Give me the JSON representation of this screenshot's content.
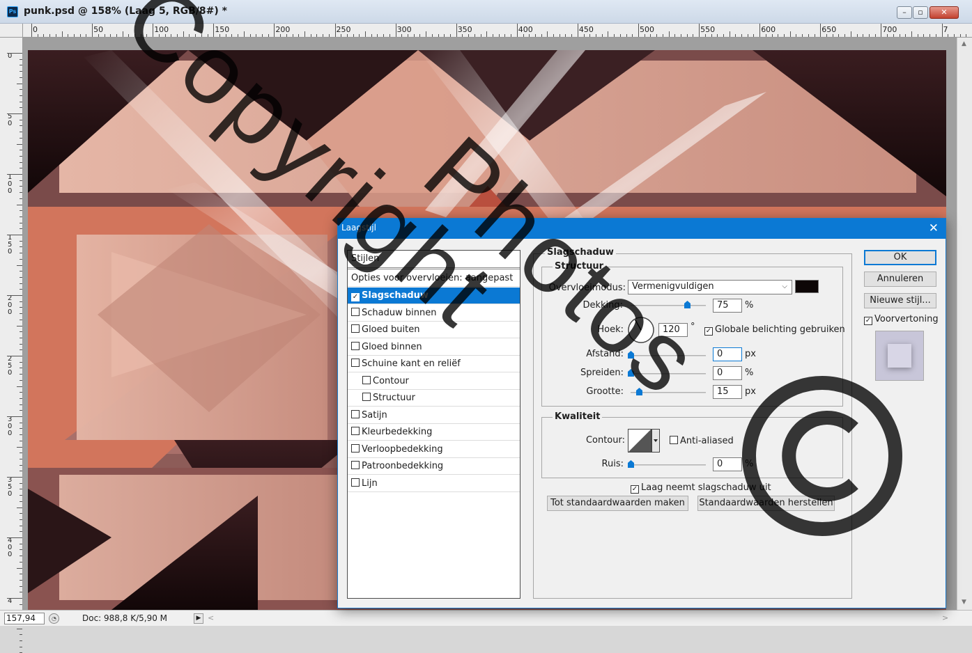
{
  "window": {
    "app_icon_label": "Ps",
    "title": "punk.psd @ 158% (Laag 5, RGB/8#) *",
    "min_glyph": "–",
    "max_glyph": "▫",
    "close_glyph": "✕"
  },
  "ruler_top_labels": [
    "0",
    "50",
    "100",
    "150",
    "200",
    "250",
    "300",
    "350",
    "400",
    "450",
    "500",
    "550",
    "600",
    "650",
    "700",
    "7"
  ],
  "ruler_left_labels": [
    "0",
    "50",
    "100",
    "150",
    "200",
    "250",
    "300",
    "350",
    "400",
    "4"
  ],
  "status": {
    "zoom": "157,94",
    "doc_info": "Doc: 988,8 K/5,90 M",
    "arrow_glyph": "▶",
    "scroll_left_glyph": "<",
    "scroll_right_glyph": ">"
  },
  "dialog": {
    "title": "Laagstijl",
    "close_glyph": "✕",
    "styles_list": {
      "header": "Stijlen",
      "blend_options": "Opties voor overvloeien: aangepast",
      "items": [
        {
          "label": "Slagschaduw",
          "checked": true,
          "selected": true,
          "indent": false
        },
        {
          "label": "Schaduw binnen",
          "checked": false,
          "selected": false,
          "indent": false
        },
        {
          "label": "Gloed buiten",
          "checked": false,
          "selected": false,
          "indent": false
        },
        {
          "label": "Gloed binnen",
          "checked": false,
          "selected": false,
          "indent": false
        },
        {
          "label": "Schuine kant en reliëf",
          "checked": false,
          "selected": false,
          "indent": false
        },
        {
          "label": "Contour",
          "checked": false,
          "selected": false,
          "indent": true
        },
        {
          "label": "Structuur",
          "checked": false,
          "selected": false,
          "indent": true
        },
        {
          "label": "Satijn",
          "checked": false,
          "selected": false,
          "indent": false
        },
        {
          "label": "Kleurbedekking",
          "checked": false,
          "selected": false,
          "indent": false
        },
        {
          "label": "Verloopbedekking",
          "checked": false,
          "selected": false,
          "indent": false
        },
        {
          "label": "Patroonbedekking",
          "checked": false,
          "selected": false,
          "indent": false
        },
        {
          "label": "Lijn",
          "checked": false,
          "selected": false,
          "indent": false
        }
      ]
    },
    "panel": {
      "heading": "Slagschaduw",
      "structure": {
        "title": "Structuur",
        "blend_mode_label": "Overvloeimodus:",
        "blend_mode_value": "Vermenigvuldigen",
        "shadow_color": "#0d0707",
        "opacity_label": "Dekking:",
        "opacity_value": "75",
        "opacity_unit": "%",
        "opacity_level": 0.75,
        "angle_label": "Hoek:",
        "angle_value": "120",
        "angle_unit": "°",
        "global_light_label": "Globale belichting gebruiken",
        "global_light_checked": true,
        "distance_label": "Afstand:",
        "distance_value": "0",
        "distance_unit": "px",
        "spread_label": "Spreiden:",
        "spread_value": "0",
        "spread_unit": "%",
        "size_label": "Grootte:",
        "size_value": "15",
        "size_unit": "px"
      },
      "quality": {
        "title": "Kwaliteit",
        "contour_label": "Contour:",
        "antialiased_label": "Anti-aliased",
        "antialiased_checked": false,
        "noise_label": "Ruis:",
        "noise_value": "0",
        "noise_unit": "%"
      },
      "knockout_label": "Laag neemt slagschaduw uit",
      "knockout_checked": true,
      "make_default_label": "Tot standaardwaarden maken",
      "reset_default_label": "Standaardwaarden herstellen"
    },
    "buttons": {
      "ok": "OK",
      "cancel": "Annuleren",
      "new_style": "Nieuwe stijl...",
      "preview_label": "Voorvertoning",
      "preview_checked": true
    }
  },
  "watermark": "Copyright Photos ©",
  "colors": {
    "accent": "#0b79d4",
    "artwork_light": "#d8a595",
    "artwork_mid": "#b17a6e",
    "artwork_dark": "#2a1416",
    "artwork_orange": "#d2755c"
  }
}
